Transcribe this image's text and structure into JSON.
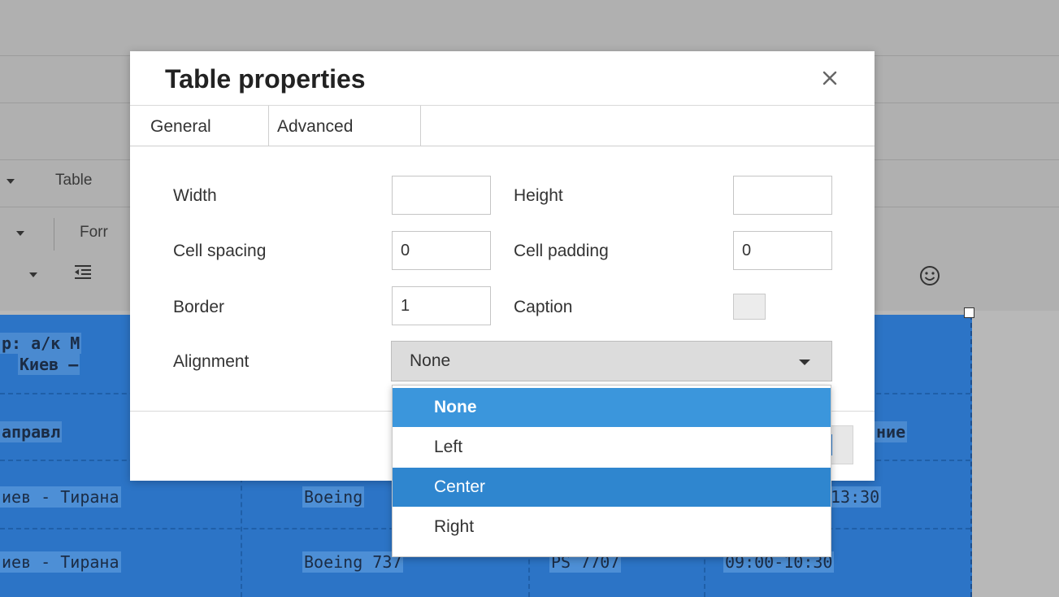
{
  "background": {
    "menubar": {
      "table_menu": "Table"
    },
    "toolbar": {
      "format_label": "Forr"
    },
    "table": {
      "header_line1": "р: а/к М",
      "header_line2": "Киев –",
      "col_header_left": "аправл",
      "col_header_right": "ние",
      "rows": [
        {
          "route": "иев - Тирана",
          "aircraft": "Boeing",
          "time": "13:30"
        },
        {
          "route": "иев - Тирана",
          "aircraft": "Boeing 737",
          "flight": "PS 7707",
          "time": "09:00-10:30"
        }
      ]
    }
  },
  "dialog": {
    "title": "Table properties",
    "tabs": [
      {
        "label": "General"
      },
      {
        "label": "Advanced"
      }
    ],
    "fields": {
      "width": {
        "label": "Width",
        "value": ""
      },
      "height": {
        "label": "Height",
        "value": ""
      },
      "cell_spacing": {
        "label": "Cell spacing",
        "value": "0"
      },
      "cell_padding": {
        "label": "Cell padding",
        "value": "0"
      },
      "border": {
        "label": "Border",
        "value": "1"
      },
      "caption": {
        "label": "Caption",
        "checked": false
      },
      "alignment": {
        "label": "Alignment",
        "value": "None"
      }
    }
  },
  "alignment_dropdown": {
    "options": [
      "None",
      "Left",
      "Center",
      "Right"
    ],
    "selected": "None",
    "highlighted": "Center"
  }
}
